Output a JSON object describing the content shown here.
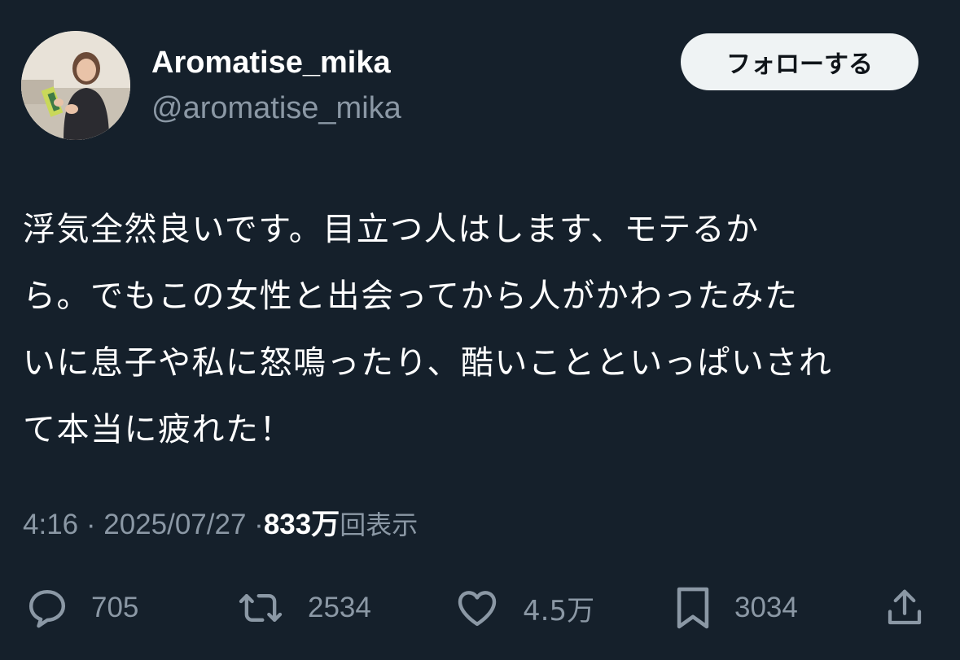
{
  "user": {
    "display_name": "Aromatise_mika",
    "handle": "@aromatise_mika",
    "avatar_icon": "profile-photo"
  },
  "follow_button": {
    "label": "フォローする"
  },
  "post": {
    "lines": [
      "浮気全然良いです。目立つ人はします、モテるか",
      "ら。でもこの女性と出会ってから人がかわったみた",
      "いに息子や私に怒鳴ったり、酷いことといっぱいされ",
      "て本当に疲れた！"
    ]
  },
  "meta": {
    "time": "4:16",
    "separator": "·",
    "date": "2025/07/27",
    "views_count": "833万",
    "views_label": "回表示"
  },
  "actions": {
    "replies": {
      "count": "705",
      "icon": "reply-icon"
    },
    "reposts": {
      "count": "2534",
      "icon": "repost-icon"
    },
    "likes": {
      "count": "4.5万",
      "icon": "heart-icon"
    },
    "bookmarks": {
      "count": "3034",
      "icon": "bookmark-icon"
    },
    "share": {
      "icon": "share-icon"
    }
  },
  "colors": {
    "background": "#15202b",
    "text_primary": "#ffffff",
    "text_secondary": "#8b98a5",
    "button_bg": "#eff3f4",
    "button_text": "#0f1419"
  }
}
